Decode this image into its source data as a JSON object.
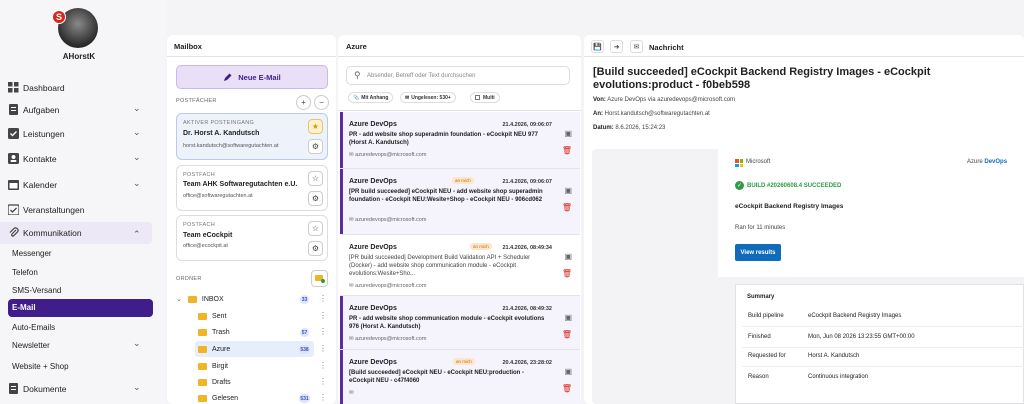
{
  "user": {
    "avatar_letter": "S",
    "name": "AHorstK"
  },
  "nav": {
    "dashboard": "Dashboard",
    "aufgaben": "Aufgaben",
    "leistungen": "Leistungen",
    "kontakte": "Kontakte",
    "kalender": "Kalender",
    "veranstaltungen": "Veranstaltungen",
    "kommunikation": "Kommunikation",
    "messenger": "Messenger",
    "telefon": "Telefon",
    "sms": "SMS-Versand",
    "email": "E-Mail",
    "autoemails": "Auto-Emails",
    "newsletter": "Newsletter",
    "website": "Website + Shop",
    "dokumente": "Dokumente"
  },
  "mailbox": {
    "title": "Mailbox",
    "new_email": "Neue E-Mail",
    "postfaecher": "POSTFÄCHER",
    "ordner": "ORDNER",
    "accounts": [
      {
        "caption": "AKTIVER POSTEINGANG",
        "name": "Dr. Horst A. Kandutsch",
        "email": "horst.kandutsch@softwaregutachten.at"
      },
      {
        "caption": "POSTFACH",
        "name": "Team AHK Softwaregutachten e.U.",
        "email": "office@softwaregutachten.at"
      },
      {
        "caption": "POSTFACH",
        "name": "Team eCockpit",
        "email": "office@ecockpit.at"
      }
    ],
    "folders": [
      {
        "name": "INBOX",
        "count": "33"
      },
      {
        "name": "Sent",
        "count": ""
      },
      {
        "name": "Trash",
        "count": "57"
      },
      {
        "name": "Azure",
        "count": "538"
      },
      {
        "name": "Birgit",
        "count": ""
      },
      {
        "name": "Drafts",
        "count": ""
      },
      {
        "name": "Gelesen",
        "count": "531"
      }
    ]
  },
  "list": {
    "title": "Azure",
    "search_placeholder": "Absender, Betreff oder Text durchsuchen",
    "filter_attachment": "Mit Anhang",
    "filter_unread": "Ungelesen: 530+",
    "filter_multi": "Multi",
    "mails": [
      {
        "from": "Azure DevOps",
        "date": "21.4.2026, 09:06:07",
        "badge": "",
        "subject": "PR - add website shop superadmin foundation - eCockpit NEU 977 (Horst A. Kandutsch)",
        "addr": "azuredevops@microsoft.com"
      },
      {
        "from": "Azure DevOps",
        "date": "21.4.2026, 09:06:07",
        "badge": "an mich",
        "subject": "[PR build succeeded] eCockpit NEU - add website shop superadmin foundation - eCockpit NEU:Wesite+Shop - eCockpit NEU - 906cd062",
        "addr": "azuredevops@microsoft.com"
      },
      {
        "from": "Azure DevOps",
        "date": "21.4.2026, 08:49:34",
        "badge": "an mich",
        "subject": "[PR build succeeded] Development Build Validation API + Scheduler (Docker) - add website shop communication module - eCockpit evolutions:Wesite+Sho...",
        "addr": "azuredevops@microsoft.com"
      },
      {
        "from": "Azure DevOps",
        "date": "21.4.2026, 08:49:32",
        "badge": "",
        "subject": "PR - add website shop communication module - eCockpit evolutions 976 (Horst A. Kandutsch)",
        "addr": "azuredevops@microsoft.com"
      },
      {
        "from": "Azure DevOps",
        "date": "20.4.2026, 23:28:02",
        "badge": "an mich",
        "subject": "[Build succeeded] eCockpit NEU - eCockpit NEU:production - eCockpit NEU - c47f4060",
        "addr": ""
      }
    ]
  },
  "message": {
    "header": "Nachricht",
    "subject": "[Build succeeded] eCockpit Backend Registry Images - eCockpit evolutions:product - f0beb598",
    "from_label": "Von:",
    "from": "Azure DevOps via azuredevops@microsoft.com",
    "to_label": "An:",
    "to": "Horst.kandutsch@softwaregutachten.at",
    "date_label": "Datum:",
    "date": "8.6.2026, 15:24:23",
    "ms_brand": "Microsoft",
    "azure_label": "Azure",
    "devops_label": "DevOps",
    "build_status": "BUILD #20260608.4 SUCCEEDED",
    "pipeline_title": "eCockpit Backend Registry Images",
    "ran_for": "Ran for 11 minutes",
    "view_results": "View results",
    "summary_title": "Summary",
    "summary": [
      {
        "k": "Build pipeline",
        "v": "eCockpit Backend Registry Images"
      },
      {
        "k": "Finished",
        "v": "Mon, Jun 08 2026 13:23:55 GMT+00:00"
      },
      {
        "k": "Requested for",
        "v": "Horst A. Kandutsch"
      },
      {
        "k": "Reason",
        "v": "Continuous integration"
      }
    ]
  },
  "colors": {
    "accent": "#5a2ca0",
    "active_nav": "#3f1d8a",
    "success": "#2e9b47",
    "ms_blue": "#0f6cbd"
  }
}
